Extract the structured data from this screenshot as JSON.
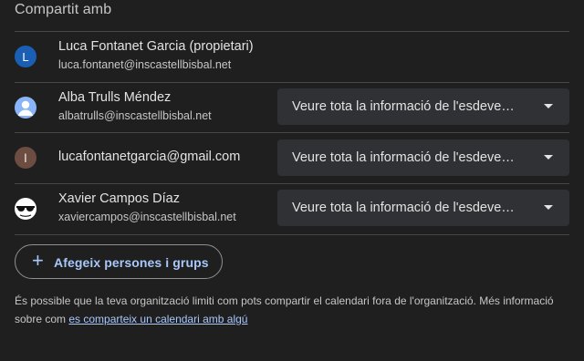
{
  "section": {
    "title": "Compartit amb"
  },
  "people": [
    {
      "name": "Luca Fontanet Garcia (propietari)",
      "email": "luca.fontanet@inscastellbisbal.net",
      "avatar_initial": "L",
      "avatar_color": "#1a5fb4"
    },
    {
      "name": "Alba Trulls Méndez",
      "email": "albatrulls@inscastellbisbal.net",
      "avatar_icon": "person-icon",
      "avatar_color": "#8ab4f8",
      "permission": "Veure tota la informació de l'esdeveniment"
    },
    {
      "name": "lucafontanetgarcia@gmail.com",
      "avatar_initial": "l",
      "avatar_color": "#6d4c41",
      "permission": "Veure tota la informació de l'esdeveniment"
    },
    {
      "name": "Xavier Campos Díaz",
      "email": "xaviercampos@inscastellbisbal.net",
      "avatar_icon": "sunglasses-icon",
      "avatar_color": "#ffffff",
      "permission": "Veure tota la informació de l'esdeveniment"
    }
  ],
  "add_button": {
    "icon": "plus-icon",
    "label": "Afegeix persones i grups"
  },
  "note": {
    "text": "És possible que la teva organització limiti com pots compartir el calendari fora de l'organització. Més informació sobre com ",
    "link": "es comparteix un calendari amb algú"
  }
}
